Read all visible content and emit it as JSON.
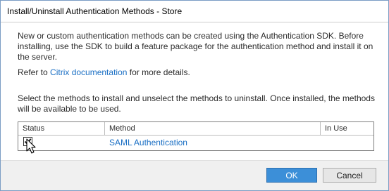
{
  "dialog": {
    "title": "Install/Uninstall Authentication Methods - Store"
  },
  "intro": {
    "text": "New or custom authentication methods can be created using the Authentication SDK. Before installing, use the SDK to build a feature package for the authentication method and install it on the server."
  },
  "refer": {
    "prefix": "Refer to ",
    "link_text": "Citrix documentation",
    "suffix": " for more details."
  },
  "instructions": {
    "text": "Select the methods to install and unselect the methods to uninstall. Once installed, the methods will be available to be used."
  },
  "table": {
    "columns": [
      "Status",
      "Method",
      "In Use"
    ],
    "rows": [
      {
        "status_checked": true,
        "method": "SAML Authentication",
        "in_use": ""
      }
    ]
  },
  "buttons": {
    "ok": "OK",
    "cancel": "Cancel"
  },
  "colors": {
    "link": "#1a6fc4",
    "ok_button": "#3c8fd8",
    "dialog_border": "#7a9cc4",
    "footer": "#f0f0f0"
  },
  "icons": {
    "checkbox": "checkmark-icon",
    "cursor": "mouse-pointer-icon"
  }
}
